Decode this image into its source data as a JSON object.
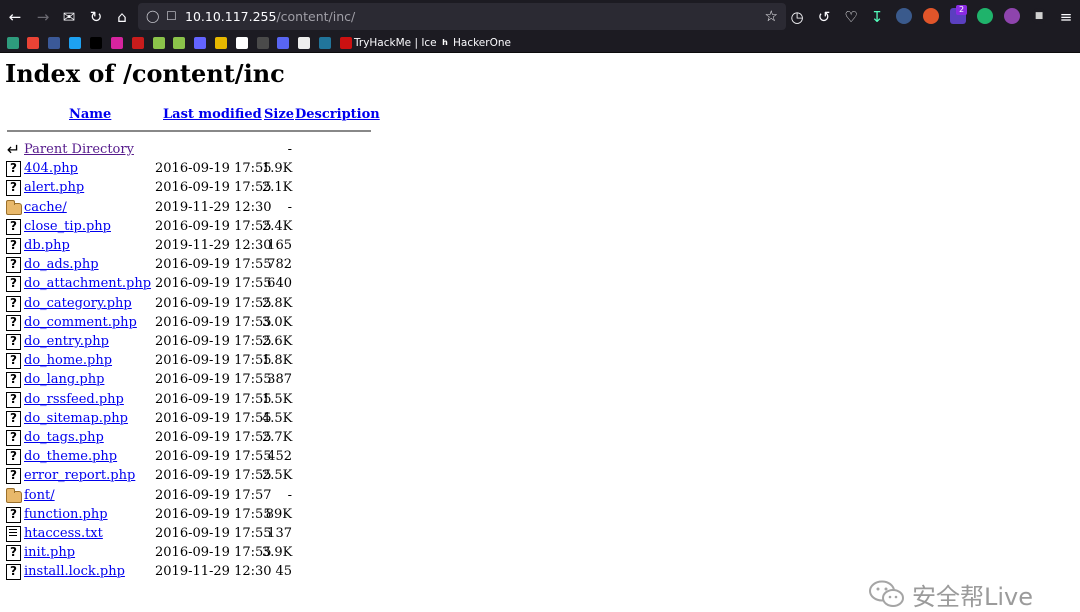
{
  "browser": {
    "url_host": "10.10.117.255",
    "url_path": "/content/inc/",
    "toolbar_icons": [
      "back-icon",
      "forward-icon",
      "mail-icon",
      "reload-icon",
      "home-icon",
      "shield-icon",
      "lock-icon",
      "star-icon",
      "history-icon",
      "undo-icon",
      "pocket-icon",
      "download-icon"
    ],
    "extension_badge": "2",
    "bookmarks": [
      {
        "label": "TryHackMe | Ice"
      },
      {
        "label": "HackerOne"
      }
    ]
  },
  "page": {
    "title": "Index of /content/inc",
    "columns": {
      "name": "Name",
      "last_modified": "Last modified",
      "size": "Size",
      "description": "Description"
    },
    "rows": [
      {
        "icon": "back",
        "name": "Parent Directory",
        "date": "",
        "size": "-"
      },
      {
        "icon": "file",
        "name": "404.php",
        "date": "2016-09-19 17:55",
        "size": "1.9K"
      },
      {
        "icon": "file",
        "name": "alert.php",
        "date": "2016-09-19 17:55",
        "size": "2.1K"
      },
      {
        "icon": "folder",
        "name": "cache/",
        "date": "2019-11-29 12:30",
        "size": "-"
      },
      {
        "icon": "file",
        "name": "close_tip.php",
        "date": "2016-09-19 17:55",
        "size": "2.4K"
      },
      {
        "icon": "file",
        "name": "db.php",
        "date": "2019-11-29 12:30",
        "size": "165"
      },
      {
        "icon": "file",
        "name": "do_ads.php",
        "date": "2016-09-19 17:55",
        "size": "782"
      },
      {
        "icon": "file",
        "name": "do_attachment.php",
        "date": "2016-09-19 17:55",
        "size": "640"
      },
      {
        "icon": "file",
        "name": "do_category.php",
        "date": "2016-09-19 17:55",
        "size": "2.8K"
      },
      {
        "icon": "file",
        "name": "do_comment.php",
        "date": "2016-09-19 17:55",
        "size": "3.0K"
      },
      {
        "icon": "file",
        "name": "do_entry.php",
        "date": "2016-09-19 17:55",
        "size": "2.6K"
      },
      {
        "icon": "file",
        "name": "do_home.php",
        "date": "2016-09-19 17:55",
        "size": "1.8K"
      },
      {
        "icon": "file",
        "name": "do_lang.php",
        "date": "2016-09-19 17:55",
        "size": "387"
      },
      {
        "icon": "file",
        "name": "do_rssfeed.php",
        "date": "2016-09-19 17:55",
        "size": "1.5K"
      },
      {
        "icon": "file",
        "name": "do_sitemap.php",
        "date": "2016-09-19 17:55",
        "size": "4.5K"
      },
      {
        "icon": "file",
        "name": "do_tags.php",
        "date": "2016-09-19 17:55",
        "size": "2.7K"
      },
      {
        "icon": "file",
        "name": "do_theme.php",
        "date": "2016-09-19 17:55",
        "size": "452"
      },
      {
        "icon": "file",
        "name": "error_report.php",
        "date": "2016-09-19 17:55",
        "size": "2.5K"
      },
      {
        "icon": "folder",
        "name": "font/",
        "date": "2016-09-19 17:57",
        "size": "-"
      },
      {
        "icon": "file",
        "name": "function.php",
        "date": "2016-09-19 17:55",
        "size": "89K"
      },
      {
        "icon": "text",
        "name": "htaccess.txt",
        "date": "2016-09-19 17:55",
        "size": "137"
      },
      {
        "icon": "file",
        "name": "init.php",
        "date": "2016-09-19 17:55",
        "size": "3.9K"
      },
      {
        "icon": "file",
        "name": "install.lock.php",
        "date": "2019-11-29 12:30",
        "size": "45"
      }
    ]
  },
  "watermark": {
    "text": "安全帮Live"
  },
  "colors": {
    "link": "#0000ee",
    "visited": "#551a8b",
    "chrome_bg": "#1c1b22",
    "urlbar_bg": "#2b2a33"
  }
}
